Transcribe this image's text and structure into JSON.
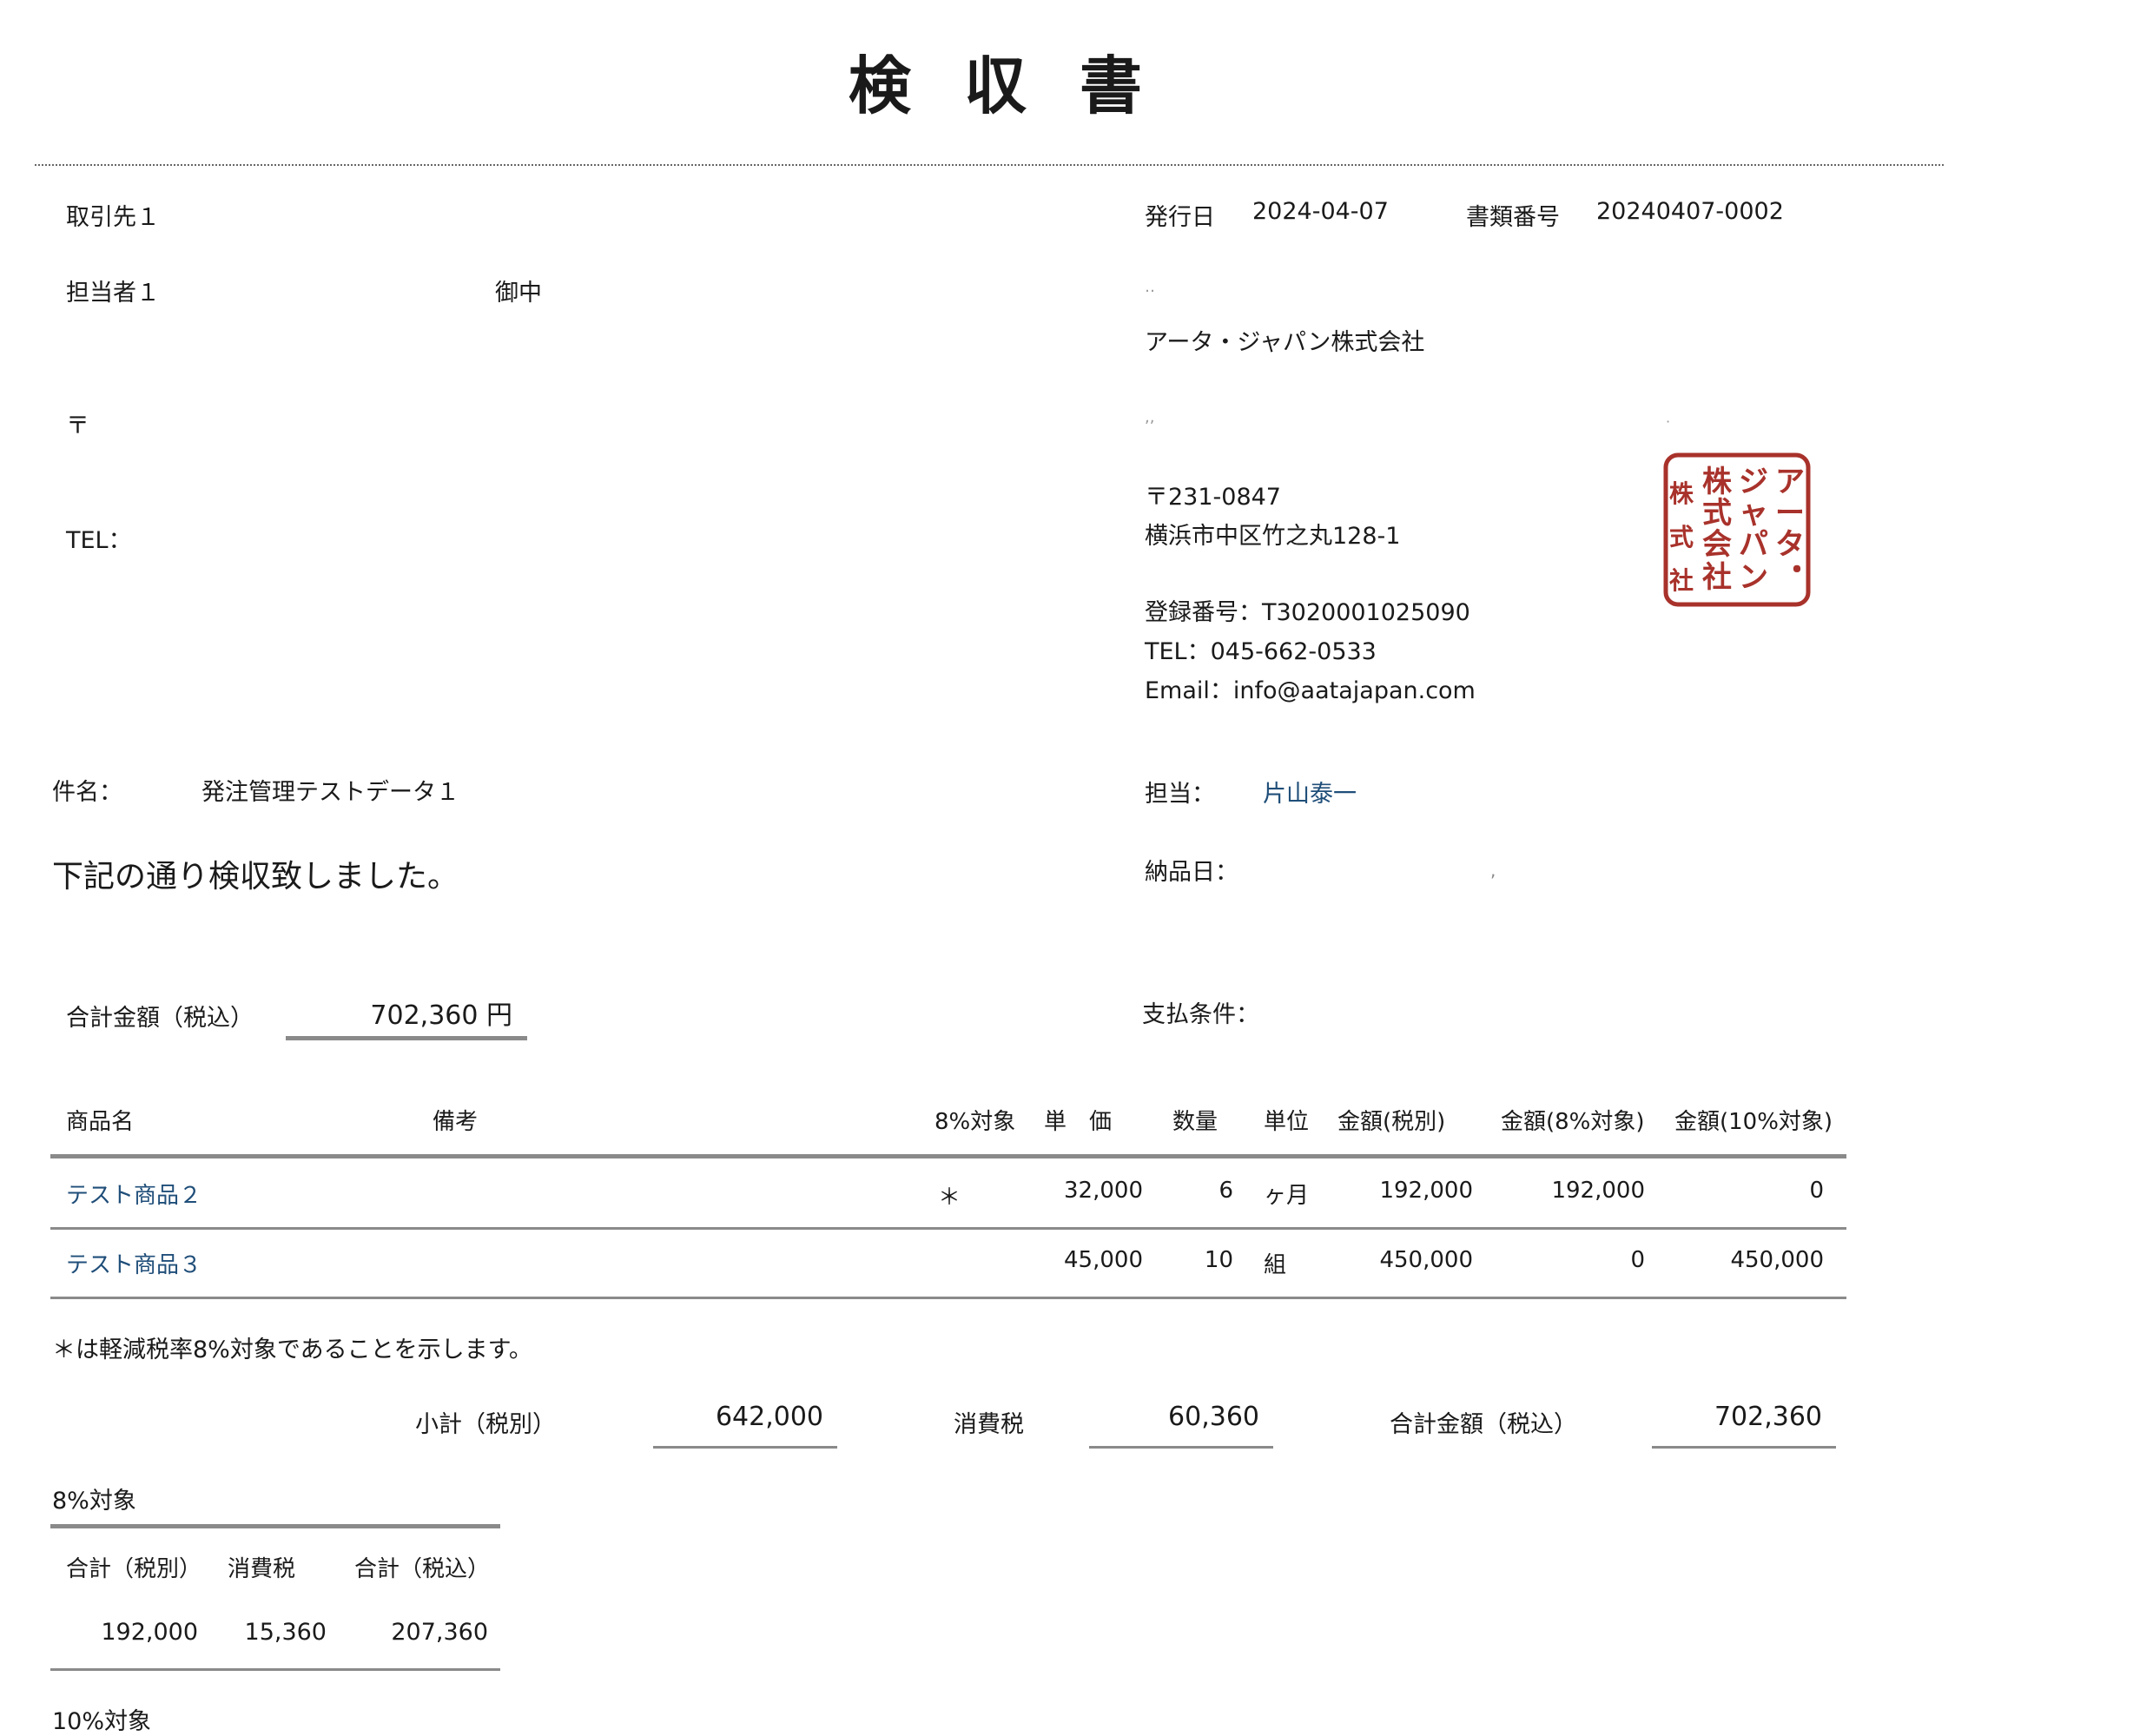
{
  "title": "検 収 書",
  "recipient": {
    "company": "取引先１",
    "person": "担当者１",
    "honorific": "御中",
    "postal_mark": "〒",
    "tel_label": "TEL："
  },
  "issue": {
    "date_label": "発行日",
    "date": "2024-04-07",
    "docnum_label": "書類番号",
    "docnum": "20240407-0002"
  },
  "issuer": {
    "dots1": "‥",
    "name": "アータ・ジャパン株式会社",
    "dots2": ",,",
    "dot3": "·",
    "postal": "〒231-0847",
    "address": "横浜市中区竹之丸128-1",
    "reg": "登録番号：T3020001025090",
    "tel": "TEL：045-662-0533",
    "email": "Email：info@aatajapan.com",
    "seal_text": "アータ・ジャパン株式会社"
  },
  "subject": {
    "label": "件名：",
    "value": "発注管理テストデータ１",
    "note": "下記の通り検収致しました。"
  },
  "contact": {
    "label": "担当：",
    "value": "片山泰一"
  },
  "delivery": {
    "label": "納品日：",
    "value": ","
  },
  "total": {
    "label": "合計金額（税込）",
    "value": "702,360 円"
  },
  "payment": {
    "label": "支払条件："
  },
  "table": {
    "headers": [
      "商品名",
      "備考",
      "8%対象",
      "単　価",
      "数量",
      "単位",
      "金額(税別)",
      "金額(8%対象)",
      "金額(10%対象)"
    ],
    "rows": [
      {
        "name": "テスト商品２",
        "note": "",
        "reduced": "＊",
        "price": "32,000",
        "qty": "6",
        "unit": "ヶ月",
        "amount": "192,000",
        "amt8": "192,000",
        "amt10": "0"
      },
      {
        "name": "テスト商品３",
        "note": "",
        "reduced": "",
        "price": "45,000",
        "qty": "10",
        "unit": "組",
        "amount": "450,000",
        "amt8": "0",
        "amt10": "450,000"
      }
    ],
    "footnote": "＊は軽減税率8%対象であることを示します。"
  },
  "summary": {
    "subtotal_label": "小計（税別）",
    "subtotal": "642,000",
    "tax_label": "消費税",
    "tax": "60,360",
    "total_label": "合計金額（税込）",
    "total": "702,360"
  },
  "rate8": {
    "title": "8%対象",
    "headers": [
      "合計（税別）",
      "消費税",
      "合計（税込）"
    ],
    "values": [
      "192,000",
      "15,360",
      "207,360"
    ]
  },
  "rate10": {
    "title": "10%対象"
  },
  "colors": {
    "link_blue": "#1f4e79",
    "seal_red": "#a8322b",
    "rule_gray": "#8a8a8a"
  }
}
